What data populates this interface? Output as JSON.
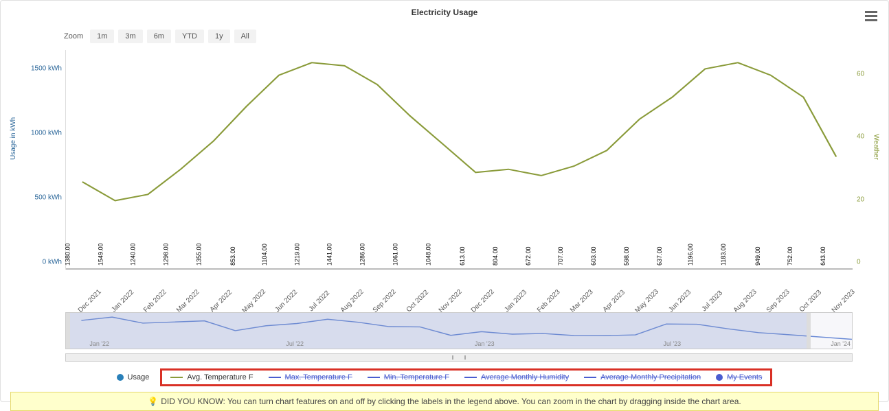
{
  "title": "Electricity Usage",
  "zoom": {
    "label": "Zoom",
    "buttons": [
      "1m",
      "3m",
      "6m",
      "YTD",
      "1y",
      "All"
    ]
  },
  "y_left": {
    "title": "Usage in kWh",
    "ticks": [
      0,
      500,
      1000,
      1500
    ],
    "unit": " kWh",
    "max": 1700
  },
  "y_right": {
    "title": "Weather",
    "ticks": [
      0,
      20,
      40,
      60
    ],
    "max": 70
  },
  "legend": {
    "usage": "Usage",
    "avg_temp": "Avg. Temperature F",
    "max_temp": "Max. Temperature F",
    "min_temp": "Min. Temperature F",
    "humidity": "Average Monthly Humidity",
    "precip": "Average Monthly Precipitation",
    "events": "My Events"
  },
  "colors": {
    "bar": "#2980b9",
    "avg_temp": "#8a9b3a",
    "off_series": "#4a5dd0",
    "events": "#4a5dd0",
    "highlight_box": "#d93025"
  },
  "navigator": {
    "ticks": [
      "Jan '22",
      "Jul '22",
      "Jan '23",
      "Jul '23",
      "Jan '24"
    ]
  },
  "tip": "DID YOU KNOW: You can turn chart features on and off by clicking the labels in the legend above. You can zoom in the chart by dragging inside the chart area.",
  "chart_data": {
    "type": "bar",
    "title": "Electricity Usage",
    "ylabel": "Usage in kWh",
    "y2label": "Weather",
    "ylim": [
      0,
      1700
    ],
    "y2lim": [
      0,
      70
    ],
    "categories": [
      "Dec 2021",
      "Jan 2022",
      "Feb 2022",
      "Mar 2022",
      "Apr 2022",
      "May 2022",
      "Jun 2022",
      "Jul 2022",
      "Aug 2022",
      "Sep 2022",
      "Oct 2022",
      "Nov 2022",
      "Dec 2022",
      "Jan 2023",
      "Feb 2023",
      "Mar 2023",
      "Apr 2023",
      "May 2023",
      "Jun 2023",
      "Jul 2023",
      "Aug 2023",
      "Sep 2023",
      "Oct 2023",
      "Nov 2023"
    ],
    "series": [
      {
        "name": "Usage",
        "axis": "left",
        "type": "bar",
        "values": [
          1380.0,
          1549.0,
          1240.0,
          1298.0,
          1355.0,
          853.0,
          1104.0,
          1219.0,
          1441.0,
          1286.0,
          1061.0,
          1048.0,
          613.0,
          804.0,
          672.0,
          707.0,
          603.0,
          598.0,
          637.0,
          1196.0,
          1183.0,
          949.0,
          752.0,
          643.0
        ]
      },
      {
        "name": "Avg. Temperature F",
        "axis": "right",
        "type": "line",
        "values": [
          28,
          22,
          24,
          32,
          41,
          52,
          62,
          66,
          65,
          59,
          49,
          40,
          31,
          32,
          30,
          33,
          38,
          48,
          55,
          64,
          66,
          62,
          55,
          36
        ]
      },
      {
        "name": "Max. Temperature F",
        "axis": "right",
        "type": "line",
        "visible": false,
        "values": []
      },
      {
        "name": "Min. Temperature F",
        "axis": "right",
        "type": "line",
        "visible": false,
        "values": []
      },
      {
        "name": "Average Monthly Humidity",
        "axis": "right",
        "type": "line",
        "visible": false,
        "values": []
      },
      {
        "name": "Average Monthly Precipitation",
        "axis": "right",
        "type": "line",
        "visible": false,
        "values": []
      },
      {
        "name": "My Events",
        "axis": "left",
        "type": "scatter",
        "visible": false,
        "values": []
      }
    ],
    "data_labels_format": "0.00"
  }
}
